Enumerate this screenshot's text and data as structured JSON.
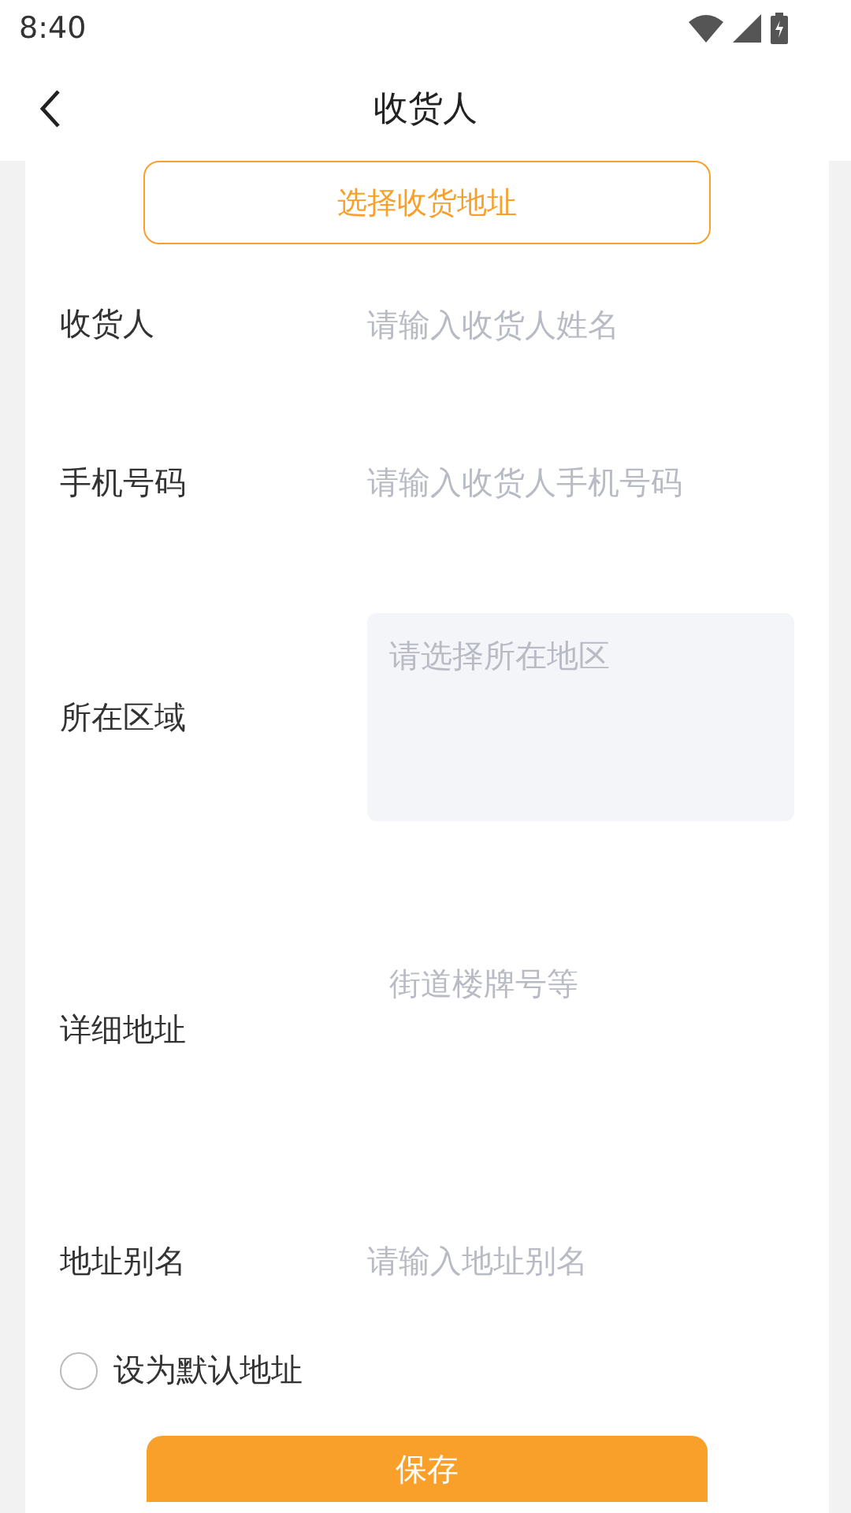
{
  "status_bar": {
    "time": "8:40"
  },
  "header": {
    "title": "收货人"
  },
  "select_address_button": "选择收货地址",
  "fields": [
    {
      "kind": "input",
      "label": "收货人",
      "placeholder": "请输入收货人姓名"
    },
    {
      "kind": "input",
      "label": "手机号码",
      "placeholder": "请输入收货人手机号码"
    },
    {
      "kind": "picker",
      "label": "所在区域",
      "placeholder": "请选择所在地区"
    },
    {
      "kind": "textarea",
      "label": "详细地址",
      "placeholder": "街道楼牌号等"
    },
    {
      "kind": "input",
      "label": "地址别名",
      "placeholder": "请输入地址别名"
    }
  ],
  "default_address": {
    "label": "设为默认地址",
    "checked": false
  },
  "save_button": "保存"
}
